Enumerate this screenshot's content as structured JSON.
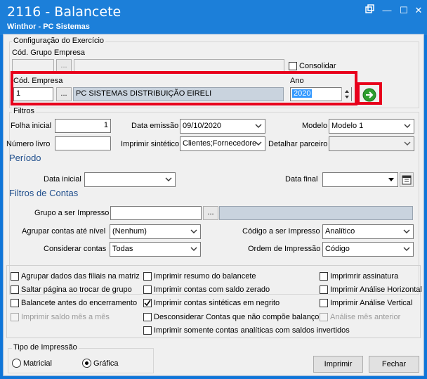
{
  "window": {
    "title": "2116 - Balancete",
    "subtitle": "Winthor - PC Sistemas",
    "minimize_glyph": "—",
    "maximize_glyph": "☐",
    "close_glyph": "✕"
  },
  "config": {
    "group_title": "Configuração do Exercício",
    "cod_grupo_label": "Cód. Grupo Empresa",
    "cod_grupo_value": "",
    "consolidar_label": "Consolidar",
    "consolidar_checked": false,
    "cod_empresa_label": "Cód. Empresa",
    "cod_empresa_value": "1",
    "empresa_name": "PC SISTEMAS DISTRIBUIÇÃO  EIRELI",
    "ano_label": "Ano",
    "ano_value": "2020",
    "dots": "..."
  },
  "filtros": {
    "group_title": "Filtros",
    "folha_inicial_label": "Folha inicial",
    "folha_inicial_value": "1",
    "data_emissao_label": "Data emissão",
    "data_emissao_value": "09/10/2020",
    "modelo_label": "Modelo",
    "modelo_value": "Modelo 1",
    "numero_livro_label": "Número livro",
    "numero_livro_value": "",
    "imprimir_sintetico_label": "Imprimir sintético",
    "imprimir_sintetico_value": "Clientes;Fornecedore",
    "detalhar_parceiro_label": "Detalhar parceiro",
    "detalhar_parceiro_value": ""
  },
  "periodo": {
    "title": "Período",
    "data_inicial_label": "Data inicial",
    "data_inicial_value": "",
    "data_final_label": "Data final",
    "data_final_value": ""
  },
  "filtros_contas": {
    "title": "Filtros de Contas",
    "grupo_label": "Grupo a ser Impresso",
    "grupo_value": "",
    "agrupar_nivel_label": "Agrupar contas até nível",
    "agrupar_nivel_value": "(Nenhum)",
    "codigo_impresso_label": "Código a ser Impresso",
    "codigo_impresso_value": "Analítico",
    "considerar_label": "Considerar contas",
    "considerar_value": "Todas",
    "ordem_label": "Ordem de Impressão",
    "ordem_value": "Código"
  },
  "options": [
    {
      "label": "Agrupar dados das filiais na matriz",
      "checked": false,
      "disabled": false
    },
    {
      "label": "Saltar página ao trocar de grupo",
      "checked": false,
      "disabled": false
    },
    {
      "label": "Balancete antes do encerramento",
      "checked": false,
      "disabled": false
    },
    {
      "label": "Imprimir saldo mês a mês",
      "checked": false,
      "disabled": true
    },
    {
      "label": "Imprimir resumo do balancete",
      "checked": false,
      "disabled": false
    },
    {
      "label": "Imprimir contas com saldo zerado",
      "checked": false,
      "disabled": false
    },
    {
      "label": "Imprimir contas sintéticas em negrito",
      "checked": true,
      "disabled": false
    },
    {
      "label": "Desconsiderar Contas que não compõe balanço",
      "checked": false,
      "disabled": false
    },
    {
      "label": "Imprimir somente contas analíticas com saldos invertidos",
      "checked": false,
      "disabled": false
    },
    {
      "label": "Imprimrir assinatura",
      "checked": false,
      "disabled": false
    },
    {
      "label": "Imprimir Análise Horizontal",
      "checked": false,
      "disabled": false
    },
    {
      "label": "Imprimir Análise Vertical",
      "checked": false,
      "disabled": false
    },
    {
      "label": "Análise mês anterior",
      "checked": false,
      "disabled": true
    }
  ],
  "tipo_impressao": {
    "title": "Tipo de Impressão",
    "matricial_label": "Matricial",
    "grafica_label": "Gráfica",
    "selected": "Gráfica"
  },
  "buttons": {
    "imprimir": "Imprimir",
    "fechar": "Fechar"
  },
  "colors": {
    "title_bar": "#1c7fd9",
    "highlight_border": "#e8001c",
    "section_title": "#1f4e8c",
    "go_button": "#2e9e2e"
  },
  "icons": {
    "go": "arrow-right-icon",
    "calendar": "calendar-icon"
  }
}
